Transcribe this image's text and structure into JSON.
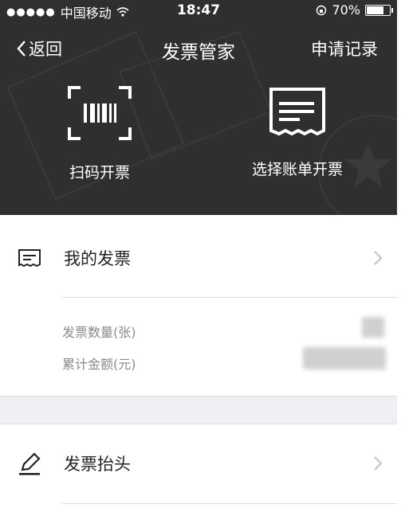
{
  "status_bar": {
    "signal": "●●●●●",
    "carrier": "中国移动",
    "time": "18:47",
    "battery": "70%",
    "battery_level": 0.7
  },
  "nav": {
    "back_label": "返回",
    "title": "发票管家",
    "right_label": "申请记录"
  },
  "actions": [
    {
      "label": "扫码开票",
      "icon": "barcode-scan-icon"
    },
    {
      "label": "选择账单开票",
      "icon": "bill-receipt-icon"
    }
  ],
  "my_invoices": {
    "label": "我的发票",
    "icon": "receipt-icon"
  },
  "stats": [
    {
      "label": "发票数量(张)"
    },
    {
      "label": "累计金额(元)"
    }
  ],
  "invoice_header": {
    "label": "发票抬头",
    "icon": "edit-pen-icon"
  },
  "colors": {
    "hero_bg": "#2f2f2f",
    "page_bg": "#ffffff",
    "separator_bg": "#efeff4",
    "muted_text": "#8a8a8a"
  }
}
